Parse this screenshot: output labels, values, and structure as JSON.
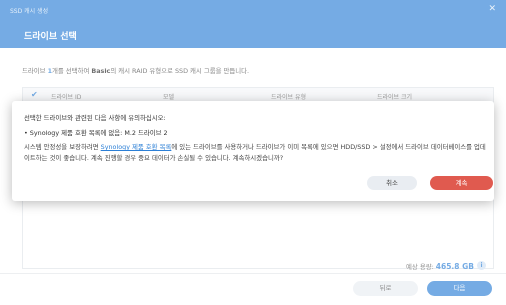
{
  "window": {
    "title": "SSD 캐시 생성",
    "close_glyph": "✕"
  },
  "header": {
    "title": "드라이브 선택"
  },
  "instruction": {
    "pre": "드라이브 ",
    "count": "1",
    "mid": "개를 선택하여 ",
    "raid": "Basic",
    "post": "의 캐시 RAID 유형으로 SSD 캐시 그룹을 만듭니다."
  },
  "table": {
    "check_glyph": "✔",
    "columns": [
      "드라이브 ID",
      "모델",
      "드라이브 유형",
      "드라이브 크기"
    ]
  },
  "footer": {
    "capacity_label": "예상 용량:",
    "capacity_value": "465.8 GB",
    "info_glyph": "i",
    "back_label": "뒤로",
    "next_label": "다음"
  },
  "dialog": {
    "intro": "선택한 드라이브와 관련된 다음 사항에 유의하십시오:",
    "bullet": "• Synology 제품 호환 목록에 없음: M.2 드라이브 2",
    "body_pre": "시스템 안정성을 보장하려면 ",
    "body_link": "Synology 제품 호환 목록",
    "body_post": "에 있는 드라이브를 사용하거나 드라이브가 이미 목록에 있으면 HDD/SSD > 설정에서 드라이브 데이터베이스를 업데이트하는 것이 좋습니다. 계속 진행할 경우 중요 데이터가 손실될 수 있습니다. 계속하시겠습니까?",
    "cancel_label": "취소",
    "continue_label": "계속"
  }
}
